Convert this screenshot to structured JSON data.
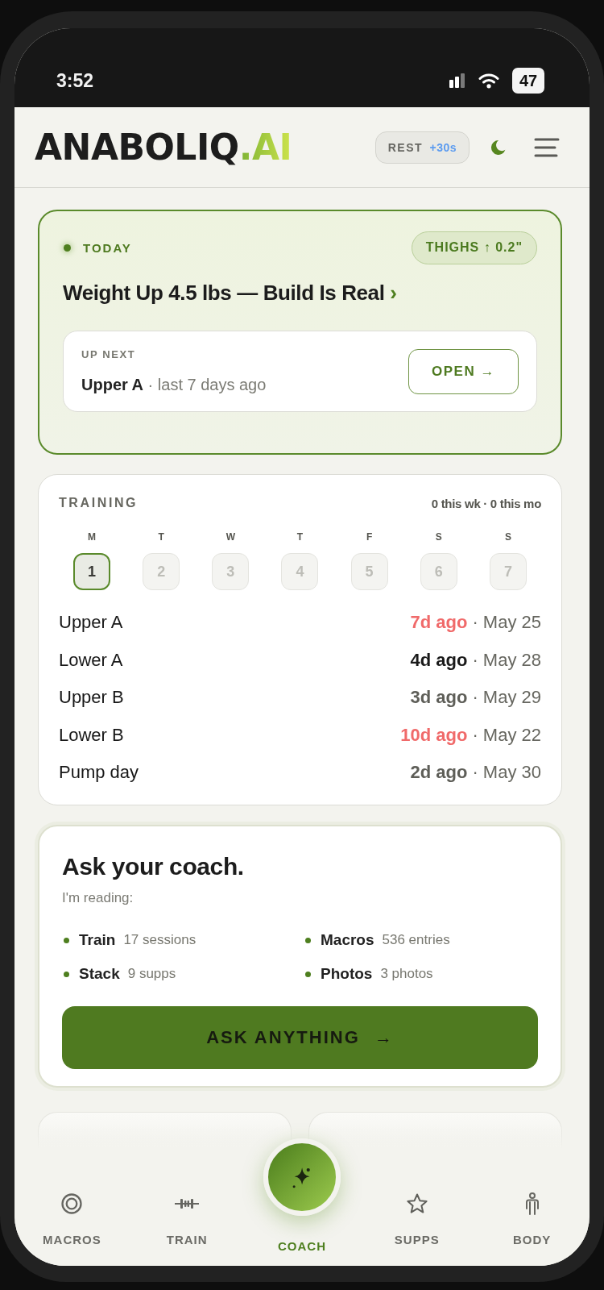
{
  "status_bar": {
    "time": "3:52",
    "battery": "47"
  },
  "header": {
    "logo": "ANABOLIQ",
    "logo_accent": ".AI",
    "rest_button": {
      "label": "REST",
      "value": "+30s"
    }
  },
  "today": {
    "label": "TODAY",
    "badge": "THIGHS ↑ 0.2\"",
    "headline": "Weight Up 4.5 lbs — Build Is Real",
    "headline_chevron": "›",
    "up_next": {
      "label": "UP NEXT",
      "text": "**Upper A** · last 7 days ago"
    },
    "open_button": "OPEN →"
  },
  "training": {
    "title": "TRAINING",
    "summary": "0 this wk · 0 this mo",
    "days": [
      {
        "letter": "M",
        "number": "1",
        "selected": true
      },
      {
        "letter": "T",
        "number": "2",
        "selected": false
      },
      {
        "letter": "W",
        "number": "3",
        "selected": false
      },
      {
        "letter": "T",
        "number": "4",
        "selected": false
      },
      {
        "letter": "F",
        "number": "5",
        "selected": false
      },
      {
        "letter": "S",
        "number": "6",
        "selected": false
      },
      {
        "letter": "S",
        "number": "7",
        "selected": false
      }
    ],
    "sessions": [
      {
        "name": "Upper A",
        "ago": "7d ago",
        "date": "· May 25",
        "color": "#f06a6a"
      },
      {
        "name": "Lower A",
        "ago": "4d ago",
        "date": "· May 28",
        "color": "#1a1a1a"
      },
      {
        "name": "Upper B",
        "ago": "3d ago",
        "date": "· May 29",
        "color": "#5e5e58"
      },
      {
        "name": "Lower B",
        "ago": "10d ago",
        "date": "· May 22",
        "color": "#f06a6a"
      },
      {
        "name": "Pump day",
        "ago": "2d ago",
        "date": "· May 30",
        "color": "#5e5e58"
      }
    ]
  },
  "coach": {
    "title": "Ask your coach.",
    "subtitle": "I'm reading:",
    "sources": [
      {
        "label": "Train",
        "count": "17 sessions"
      },
      {
        "label": "Macros",
        "count": "536 entries"
      },
      {
        "label": "Stack",
        "count": "9 supps"
      },
      {
        "label": "Photos",
        "count": "3 photos"
      }
    ],
    "button": {
      "label": "ASK ANYTHING",
      "arrow": "→"
    }
  },
  "nav": [
    {
      "label": "MACROS",
      "kind": "tab",
      "selected": false
    },
    {
      "label": "TRAIN",
      "kind": "tab",
      "selected": false
    },
    {
      "label": "COACH",
      "kind": "fab",
      "selected": true
    },
    {
      "label": "SUPPS",
      "kind": "tab",
      "selected": false
    },
    {
      "label": "BODY",
      "kind": "tab",
      "selected": false
    }
  ]
}
